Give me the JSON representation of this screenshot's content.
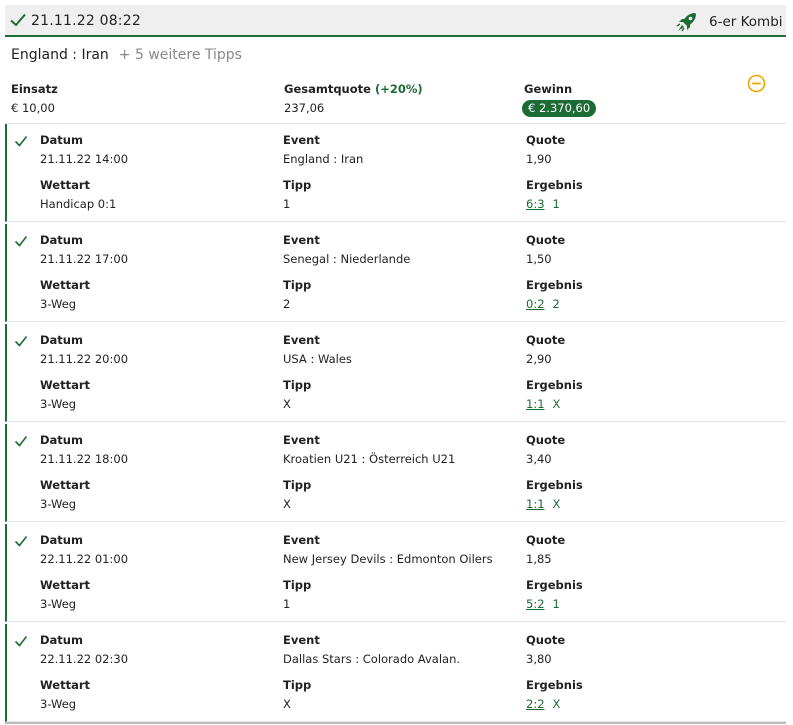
{
  "header": {
    "date": "21.11.22 08:22",
    "type": "6-er Kombi",
    "icons": {
      "status": "check-icon",
      "type": "rocket-icon"
    }
  },
  "subheader": {
    "match": "England : Iran",
    "more": "+ 5 weitere Tipps"
  },
  "summary": {
    "stake_label": "Einsatz",
    "stake_value": "€ 10,00",
    "odds_label": "Gesamtquote",
    "odds_bonus": "(+20%)",
    "odds_value": "237,06",
    "win_label": "Gewinn",
    "win_value": "€ 2.370,60"
  },
  "labels": {
    "date": "Datum",
    "event": "Event",
    "odds": "Quote",
    "bettype": "Wettart",
    "tip": "Tipp",
    "result": "Ergebnis"
  },
  "colors": {
    "accent": "#1c6b35",
    "collapse": "#f0a500",
    "header_bg": "#efefef"
  },
  "bets": [
    {
      "date": "21.11.22 14:00",
      "event": "England : Iran",
      "odds": "1,90",
      "bettype": "Handicap 0:1",
      "tip": "1",
      "score": "6:3",
      "outcome": "1"
    },
    {
      "date": "21.11.22 17:00",
      "event": "Senegal : Niederlande",
      "odds": "1,50",
      "bettype": "3-Weg",
      "tip": "2",
      "score": "0:2",
      "outcome": "2"
    },
    {
      "date": "21.11.22 20:00",
      "event": "USA : Wales",
      "odds": "2,90",
      "bettype": "3-Weg",
      "tip": "X",
      "score": "1:1",
      "outcome": "X"
    },
    {
      "date": "21.11.22 18:00",
      "event": "Kroatien U21 : Österreich U21",
      "odds": "3,40",
      "bettype": "3-Weg",
      "tip": "X",
      "score": "1:1",
      "outcome": "X"
    },
    {
      "date": "22.11.22 01:00",
      "event": "New Jersey Devils : Edmonton Oilers",
      "odds": "1,85",
      "bettype": "3-Weg",
      "tip": "1",
      "score": "5:2",
      "outcome": "1"
    },
    {
      "date": "22.11.22 02:30",
      "event": "Dallas Stars : Colorado Avalan.",
      "odds": "3,80",
      "bettype": "3-Weg",
      "tip": "X",
      "score": "2:2",
      "outcome": "X"
    }
  ]
}
